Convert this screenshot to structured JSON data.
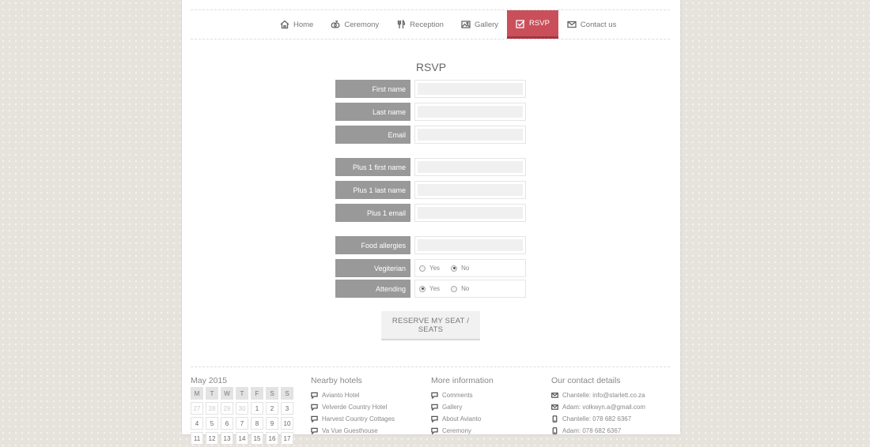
{
  "nav": [
    {
      "label": "Home",
      "icon": "home-icon"
    },
    {
      "label": "Ceremony",
      "icon": "rings-icon"
    },
    {
      "label": "Reception",
      "icon": "cutlery-icon"
    },
    {
      "label": "Gallery",
      "icon": "image-icon"
    },
    {
      "label": "RSVP",
      "icon": "checkbox-icon",
      "active": true
    },
    {
      "label": "Contact us",
      "icon": "envelope-icon"
    }
  ],
  "form": {
    "title": "RSVP",
    "first_name": "First name",
    "last_name": "Last name",
    "email": "Email",
    "plus1_first": "Plus 1 first name",
    "plus1_last": "Plus 1 last name",
    "plus1_email": "Plus 1 email",
    "food_allergies": "Food allergies",
    "vegetarian": {
      "label": "Vegiterian",
      "yes": "Yes",
      "no": "No",
      "selected": "No"
    },
    "attending": {
      "label": "Attending",
      "yes": "Yes",
      "no": "No",
      "selected": "Yes"
    },
    "submit": "RESERVE MY SEAT / SEATS"
  },
  "calendar": {
    "title": "May 2015",
    "days": [
      "M",
      "T",
      "W",
      "T",
      "F",
      "S",
      "S"
    ],
    "weeks": [
      [
        "27",
        "28",
        "29",
        "30",
        "1",
        "2",
        "3"
      ],
      [
        "4",
        "5",
        "6",
        "7",
        "8",
        "9",
        "10"
      ],
      [
        "11",
        "12",
        "13",
        "14",
        "15",
        "16",
        "17"
      ]
    ]
  },
  "hotels": {
    "title": "Nearby hotels",
    "items": [
      "Avianto Hotel",
      "Velverde Country Hotel",
      "Harvest Country Cottages",
      "Va Vue Guesthouse"
    ]
  },
  "info": {
    "title": "More information",
    "items": [
      "Comments",
      "Gallery",
      "About Avianto",
      "Ceremony"
    ]
  },
  "contact": {
    "title": "Our contact details",
    "items": [
      {
        "text": "Chantelle: info@starlett.co.za",
        "icon": "envelope-icon"
      },
      {
        "text": "Adam: volkwyn.a@gmail.com",
        "icon": "envelope-icon"
      },
      {
        "text": "Chantelle: 078 682 6367",
        "icon": "phone-icon"
      },
      {
        "text": "Adam: 078 682 6367",
        "icon": "phone-icon"
      }
    ]
  },
  "colors": {
    "accent": "#c9505b",
    "label_bg": "#999999",
    "input_bg": "#f0f0f0"
  }
}
